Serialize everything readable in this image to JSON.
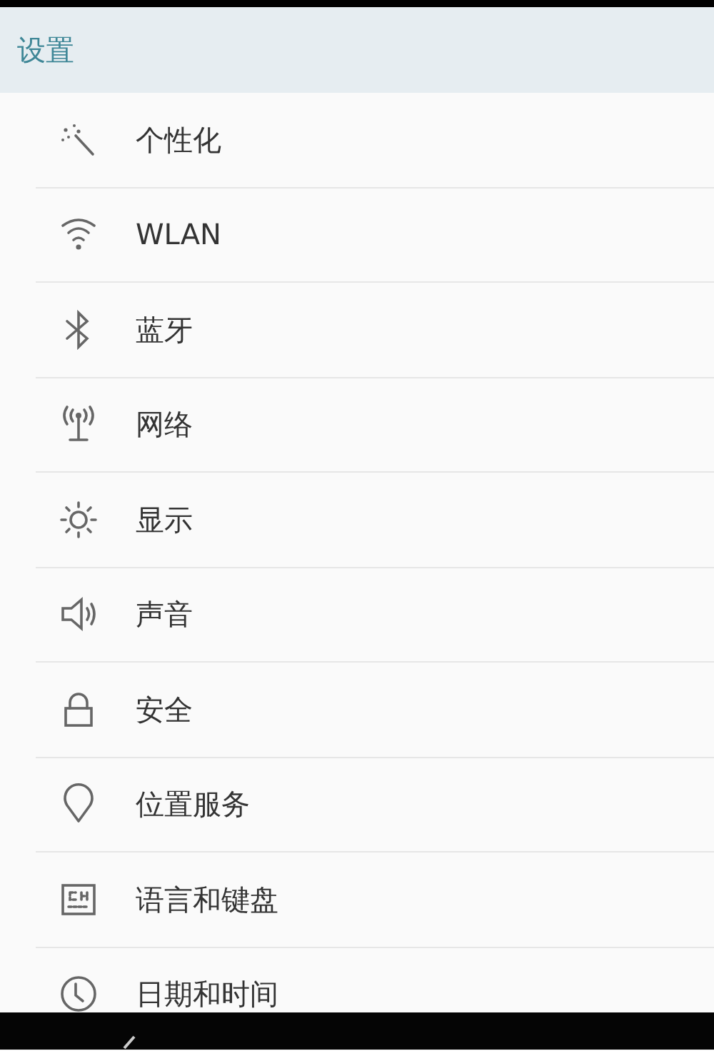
{
  "header": {
    "title": "设置"
  },
  "items": [
    {
      "label": "个性化"
    },
    {
      "label": "WLAN"
    },
    {
      "label": "蓝牙"
    },
    {
      "label": "网络"
    },
    {
      "label": "显示"
    },
    {
      "label": "声音"
    },
    {
      "label": "安全"
    },
    {
      "label": "位置服务"
    },
    {
      "label": "语言和键盘"
    },
    {
      "label": "日期和时间"
    }
  ]
}
